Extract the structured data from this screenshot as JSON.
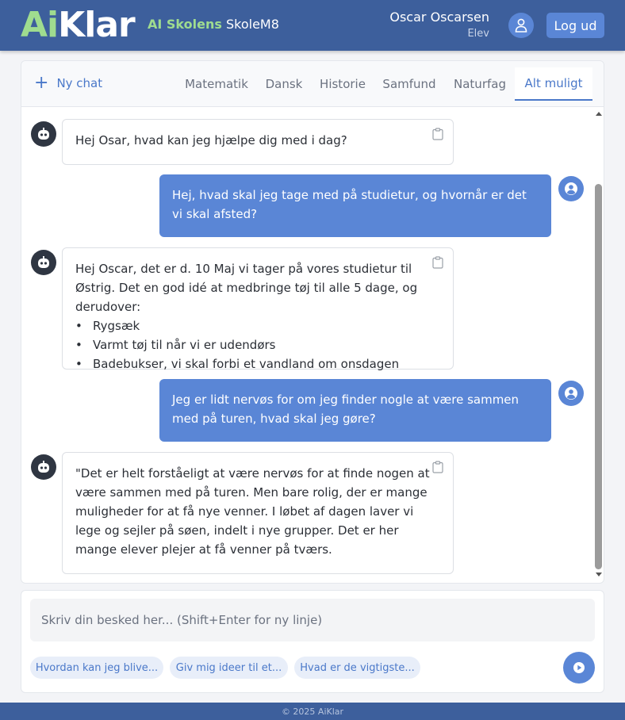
{
  "header": {
    "logo_ai": "Ai",
    "logo_klar": "Klar",
    "subtitle_green": "AI Skolens",
    "subtitle_rest": "SkoleM8",
    "user_name": "Oscar Oscarsen",
    "user_role": "Elev",
    "logout_label": "Log ud",
    "profile_icon": "user-icon"
  },
  "tabs": {
    "new_chat_label": "Ny chat",
    "items": [
      {
        "label": "Matematik"
      },
      {
        "label": "Dansk"
      },
      {
        "label": "Historie"
      },
      {
        "label": "Samfund"
      },
      {
        "label": "Naturfag"
      },
      {
        "label": "Alt muligt"
      }
    ],
    "active": "Alt muligt"
  },
  "messages": [
    {
      "role": "bot",
      "text": "Hej Osar, hvad kan jeg hjælpe dig med i dag?"
    },
    {
      "role": "user",
      "text": "Hej, hvad skal jeg tage med på studietur, og hvornår er det vi skal afsted?"
    },
    {
      "role": "bot",
      "text": "Hej Oscar, det er d. 10 Maj vi tager på vores studietur til Østrig. Det en god idé at medbringe tøj til alle 5 dage, og derudover:",
      "list": [
        "Rygsæk",
        "Varmt tøj til når vi er udendørs",
        "Badebukser, vi skal forbi et vandland om onsdagen"
      ]
    },
    {
      "role": "user",
      "text": "Jeg er lidt nervøs for om jeg finder nogle at være sammen med på turen, hvad skal jeg gøre?"
    },
    {
      "role": "bot",
      "text": "\"Det er helt forståeligt at være nervøs for at finde nogen at være sammen med på turen. Men bare rolig, der er mange muligheder for at få nye venner. I løbet af dagen laver vi lege og sejler på søen, indelt i nye grupper. Det er her mange elever plejer at få venner på tværs."
    }
  ],
  "composer": {
    "placeholder": "Skriv din besked her... (Shift+Enter for ny linje)",
    "suggestions": [
      {
        "label": "Hvordan kan jeg blive..."
      },
      {
        "label": "Giv mig ideer til et..."
      },
      {
        "label": "Hvad er de vigtigste..."
      }
    ]
  },
  "footer": {
    "text": "© 2025 AiKlar"
  },
  "colors": {
    "header": "#3d5f9c",
    "accent": "#5a86d6",
    "logo_green": "#9fdc8f",
    "bot_avatar": "#2f3642"
  }
}
